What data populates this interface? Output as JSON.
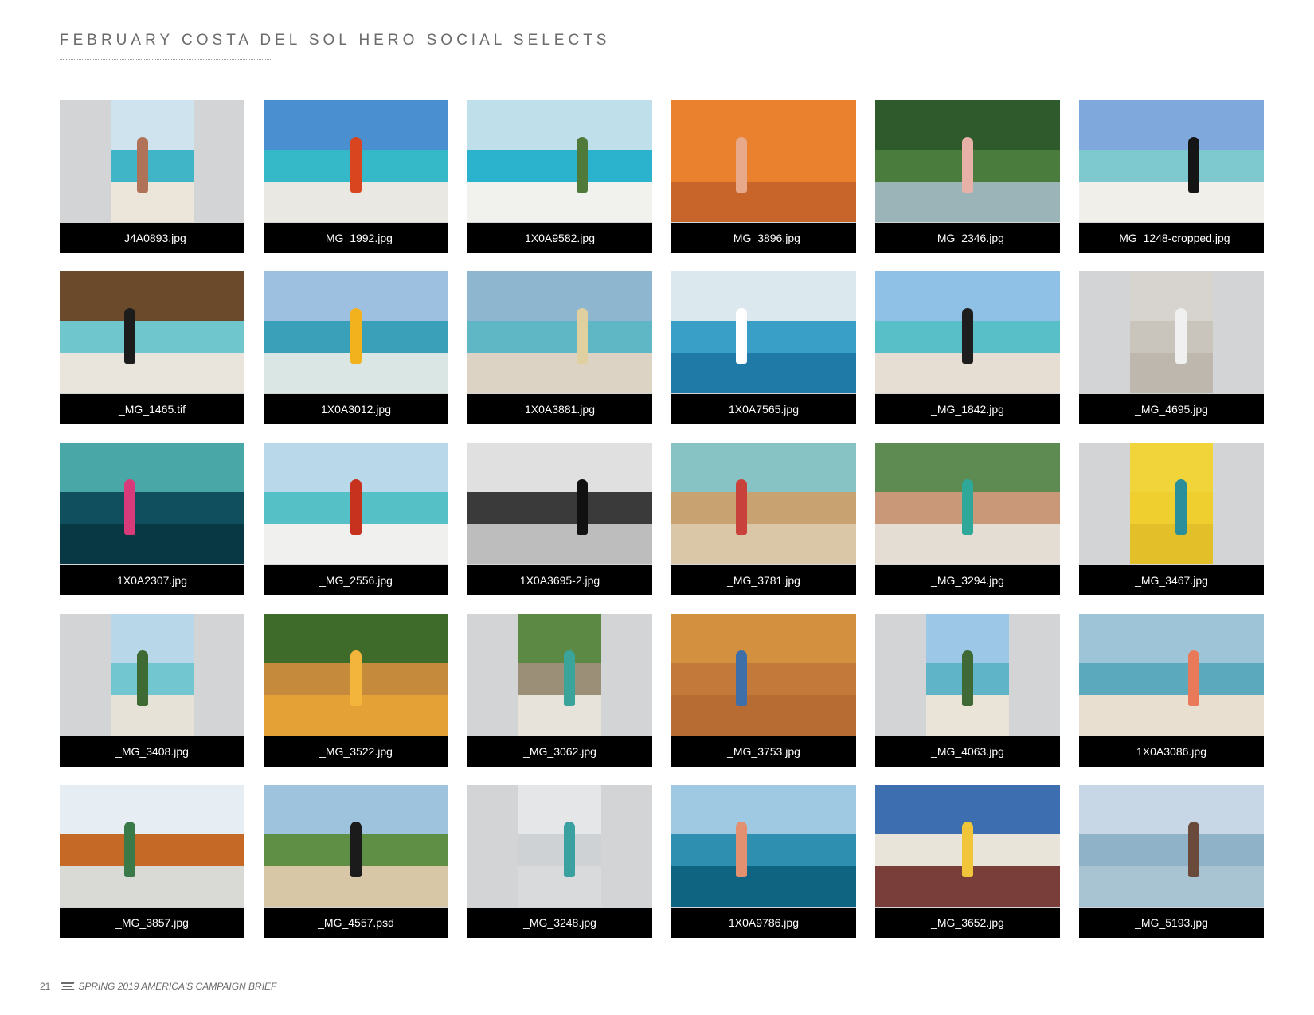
{
  "page": {
    "title": "FEBRUARY COSTA DEL SOL HERO SOCIAL SELECTS"
  },
  "footer": {
    "page_number": "21",
    "text": "SPRING 2019 AMERICA'S CAMPAIGN BRIEF"
  },
  "photos": [
    {
      "file": "_J4A0893.jpg",
      "frame": "portrait",
      "palette": [
        "#cfe3ee",
        "#3fb5c7",
        "#ece6da",
        "#b0735a"
      ]
    },
    {
      "file": "_MG_1992.jpg",
      "frame": "landscape",
      "palette": [
        "#4a8fd0",
        "#35b8c8",
        "#eae8e2",
        "#d8451f"
      ]
    },
    {
      "file": "1X0A9582.jpg",
      "frame": "landscape",
      "palette": [
        "#bfe0ea",
        "#2bb3cd",
        "#f1f1ee",
        "#4f7a3a"
      ]
    },
    {
      "file": "_MG_3896.jpg",
      "frame": "landscape",
      "palette": [
        "#e9812e",
        "#e9812e",
        "#c8652a",
        "#e8a88a"
      ]
    },
    {
      "file": "_MG_2346.jpg",
      "frame": "landscape",
      "palette": [
        "#2f5a2c",
        "#4a7c3e",
        "#9bb4b8",
        "#e8b1a8"
      ]
    },
    {
      "file": "_MG_1248-cropped.jpg",
      "frame": "landscape",
      "palette": [
        "#7fa8dc",
        "#7ec8cf",
        "#f1efe9",
        "#151515"
      ]
    },
    {
      "file": "_MG_1465.tif",
      "frame": "landscape",
      "palette": [
        "#6b4a2c",
        "#6fc6cc",
        "#e9e5dc",
        "#1c1c1c"
      ]
    },
    {
      "file": "1X0A3012.jpg",
      "frame": "landscape",
      "palette": [
        "#9ec0e0",
        "#3a9fb8",
        "#d9e6e4",
        "#f2b21e"
      ]
    },
    {
      "file": "1X0A3881.jpg",
      "frame": "landscape",
      "palette": [
        "#8eb6cf",
        "#5fb6c4",
        "#ddd3c4",
        "#e0d0a0"
      ]
    },
    {
      "file": "1X0A7565.jpg",
      "frame": "landscape",
      "palette": [
        "#dbe8ee",
        "#3a9fc7",
        "#1f7aa8",
        "#ffffff"
      ]
    },
    {
      "file": "_MG_1842.jpg",
      "frame": "landscape",
      "palette": [
        "#8fc0e5",
        "#58bfc8",
        "#e6ded2",
        "#1e1e1e"
      ]
    },
    {
      "file": "_MG_4695.jpg",
      "frame": "portrait",
      "palette": [
        "#d7d4cf",
        "#c9c5bd",
        "#bdb7ad",
        "#f0f0f0"
      ]
    },
    {
      "file": "1X0A2307.jpg",
      "frame": "landscape",
      "palette": [
        "#4aa7a8",
        "#0f4f5e",
        "#083844",
        "#d83b7a"
      ]
    },
    {
      "file": "_MG_2556.jpg",
      "frame": "landscape",
      "palette": [
        "#b9d9ea",
        "#56c0c7",
        "#f0f0ee",
        "#c7321f"
      ]
    },
    {
      "file": "1X0A3695-2.jpg",
      "frame": "landscape",
      "palette": [
        "#e0e0e0",
        "#3a3a3a",
        "#bdbdbd",
        "#111111"
      ]
    },
    {
      "file": "_MG_3781.jpg",
      "frame": "landscape",
      "palette": [
        "#87c3c4",
        "#c9a271",
        "#d9c7a8",
        "#c8413b"
      ]
    },
    {
      "file": "_MG_3294.jpg",
      "frame": "landscape",
      "palette": [
        "#5d8b52",
        "#c99878",
        "#e3ddd3",
        "#2fa89a"
      ]
    },
    {
      "file": "_MG_3467.jpg",
      "frame": "portrait",
      "palette": [
        "#f0d43a",
        "#efcf2f",
        "#e3c02a",
        "#2a8f9a"
      ]
    },
    {
      "file": "_MG_3408.jpg",
      "frame": "portrait",
      "palette": [
        "#b8d8ea",
        "#72c6d0",
        "#e7e2d8",
        "#3e6a33"
      ]
    },
    {
      "file": "_MG_3522.jpg",
      "frame": "landscape",
      "palette": [
        "#3f6b2a",
        "#c58a3b",
        "#e4a236",
        "#f3b53b"
      ]
    },
    {
      "file": "_MG_3062.jpg",
      "frame": "portrait",
      "palette": [
        "#5c8a44",
        "#9c8f78",
        "#e8e3da",
        "#3aa39a"
      ]
    },
    {
      "file": "_MG_3753.jpg",
      "frame": "landscape",
      "palette": [
        "#d3913f",
        "#c2793a",
        "#b76c33",
        "#3e6fa8"
      ]
    },
    {
      "file": "_MG_4063.jpg",
      "frame": "portrait",
      "palette": [
        "#9cc7e6",
        "#5fb4c8",
        "#eae4d8",
        "#3f6a35"
      ]
    },
    {
      "file": "1X0A3086.jpg",
      "frame": "landscape",
      "palette": [
        "#9ec4d8",
        "#5aa9bd",
        "#e9dfd0",
        "#e87a5a"
      ]
    },
    {
      "file": "_MG_3857.jpg",
      "frame": "landscape",
      "palette": [
        "#e6eef3",
        "#c46a26",
        "#d9d9d6",
        "#3a7a48"
      ]
    },
    {
      "file": "_MG_4557.psd",
      "frame": "landscape",
      "palette": [
        "#9ec3dd",
        "#5f8f44",
        "#d7c7a6",
        "#1b1b1b"
      ]
    },
    {
      "file": "_MG_3248.jpg",
      "frame": "portrait",
      "palette": [
        "#e4e6e8",
        "#cfd2d4",
        "#d9dadb",
        "#3aa0a0"
      ]
    },
    {
      "file": "1X0A9786.jpg",
      "frame": "landscape",
      "palette": [
        "#9fc9e2",
        "#2f8fb0",
        "#0f6482",
        "#e39070"
      ]
    },
    {
      "file": "_MG_3652.jpg",
      "frame": "landscape",
      "palette": [
        "#3d6fb0",
        "#e9e4da",
        "#7a3e3a",
        "#f0c53a"
      ]
    },
    {
      "file": "_MG_5193.jpg",
      "frame": "landscape",
      "palette": [
        "#c7d7e6",
        "#8fb2c8",
        "#a8c3d1",
        "#6a4a3a"
      ]
    }
  ]
}
